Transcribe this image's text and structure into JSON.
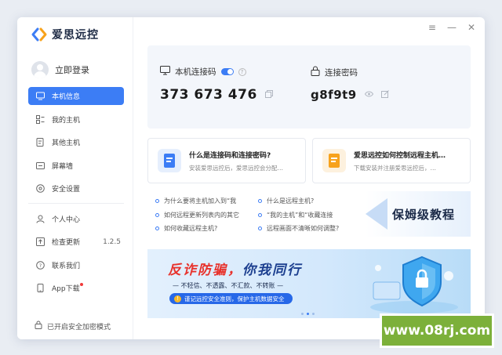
{
  "app": {
    "name": "爱思远控"
  },
  "titlebar": {
    "menu_icon": "menu-icon",
    "minimize_icon": "minimize-icon",
    "close_icon": "close-icon"
  },
  "sidebar": {
    "login_label": "立即登录",
    "items": [
      {
        "label": "本机信息",
        "icon": "monitor-icon",
        "active": true
      },
      {
        "label": "我的主机",
        "icon": "grid-icon",
        "active": false
      },
      {
        "label": "其他主机",
        "icon": "document-icon",
        "active": false
      },
      {
        "label": "屏幕墙",
        "icon": "screen-icon",
        "active": false
      },
      {
        "label": "安全设置",
        "icon": "shield-icon",
        "active": false
      }
    ],
    "bottom_items": [
      {
        "label": "个人中心",
        "icon": "user-icon"
      },
      {
        "label": "检查更新",
        "icon": "update-icon",
        "version": "1.2.5"
      },
      {
        "label": "联系我们",
        "icon": "question-icon"
      },
      {
        "label": "App下载",
        "icon": "phone-icon",
        "badge": true
      }
    ],
    "secure_mode": "已开启安全加密模式"
  },
  "connection": {
    "code_label": "本机连接码",
    "code_value": "373 673 476",
    "password_label": "连接密码",
    "password_value": "g8f9t9",
    "toggle_on": true
  },
  "info_cards": [
    {
      "title": "什么是连接码和连接密码?",
      "desc": "安装爱思远控后，爱思远控会分配…",
      "color": "#3c7df5"
    },
    {
      "title": "爱思远控如何控制远程主机…",
      "desc": "下载安装并注册爱思远控后，…",
      "color": "#f7a21c"
    }
  ],
  "faq_links": [
    [
      "为什么要将主机加入到“我",
      "什么是远程主机?"
    ],
    [
      "如何远程更新列表内的其它",
      "“我的主机”和“收藏连接"
    ],
    [
      "如何收藏远程主机?",
      "远程画面不清晰如何调整?"
    ]
  ],
  "tutorial": {
    "label": "保姆级教程"
  },
  "banner": {
    "title_red": "反诈防骗，",
    "title_blue": "你我同行",
    "subtitle": "— 不轻信、不透露、不汇款、不转账 —",
    "pill": "谨记远控安全准则，保护主机数据安全",
    "slides": 3,
    "active_slide": 1
  },
  "watermark": {
    "text": "www.08rj.com"
  }
}
